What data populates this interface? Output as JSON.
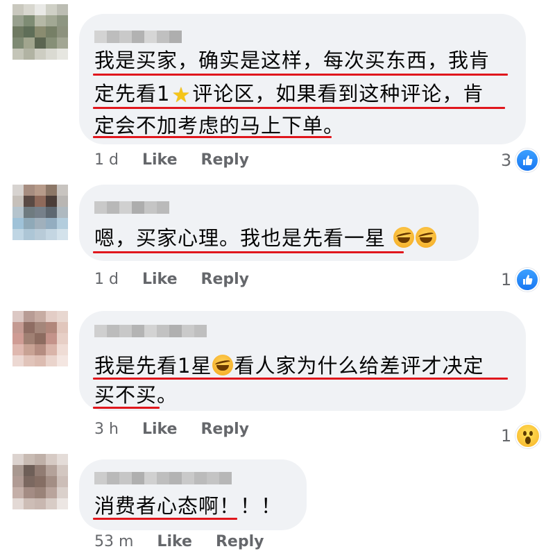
{
  "comments": [
    {
      "lines": [
        [
          "我是买家，确实是这样，每次买东西，我肯"
        ],
        [
          "定先看1",
          "star",
          "评论区，如果看到这种评论，肯"
        ],
        [
          "定会不加考虑的马上下单。"
        ]
      ],
      "time": "1 d",
      "like_label": "Like",
      "reply_label": "Reply",
      "reaction_count": "3",
      "reaction_icon": "like-icon"
    },
    {
      "lines": [
        [
          "嗯，买家心理。我也是先看一星",
          "emoji",
          "emoji"
        ]
      ],
      "time": "1 d",
      "like_label": "Like",
      "reply_label": "Reply",
      "reaction_count": "1",
      "reaction_icon": "like-icon"
    },
    {
      "lines": [
        [
          "我是先看1星",
          "emoji",
          "看人家为什么给差评才决定"
        ],
        [
          "买不买。"
        ]
      ],
      "time": "3 h",
      "like_label": "Like",
      "reply_label": "Reply",
      "reaction_count": "1",
      "reaction_icon": "wow-icon"
    },
    {
      "lines": [
        [
          "消费者心态啊！！！"
        ]
      ],
      "time": "53 m",
      "like_label": "Like",
      "reply_label": "Reply",
      "reaction_count": "",
      "reaction_icon": ""
    }
  ],
  "colors": {
    "underline": "#e0161c",
    "bubble": "#f0f2f5",
    "meta_text": "#65676b",
    "like_blue": "#1877f2"
  }
}
